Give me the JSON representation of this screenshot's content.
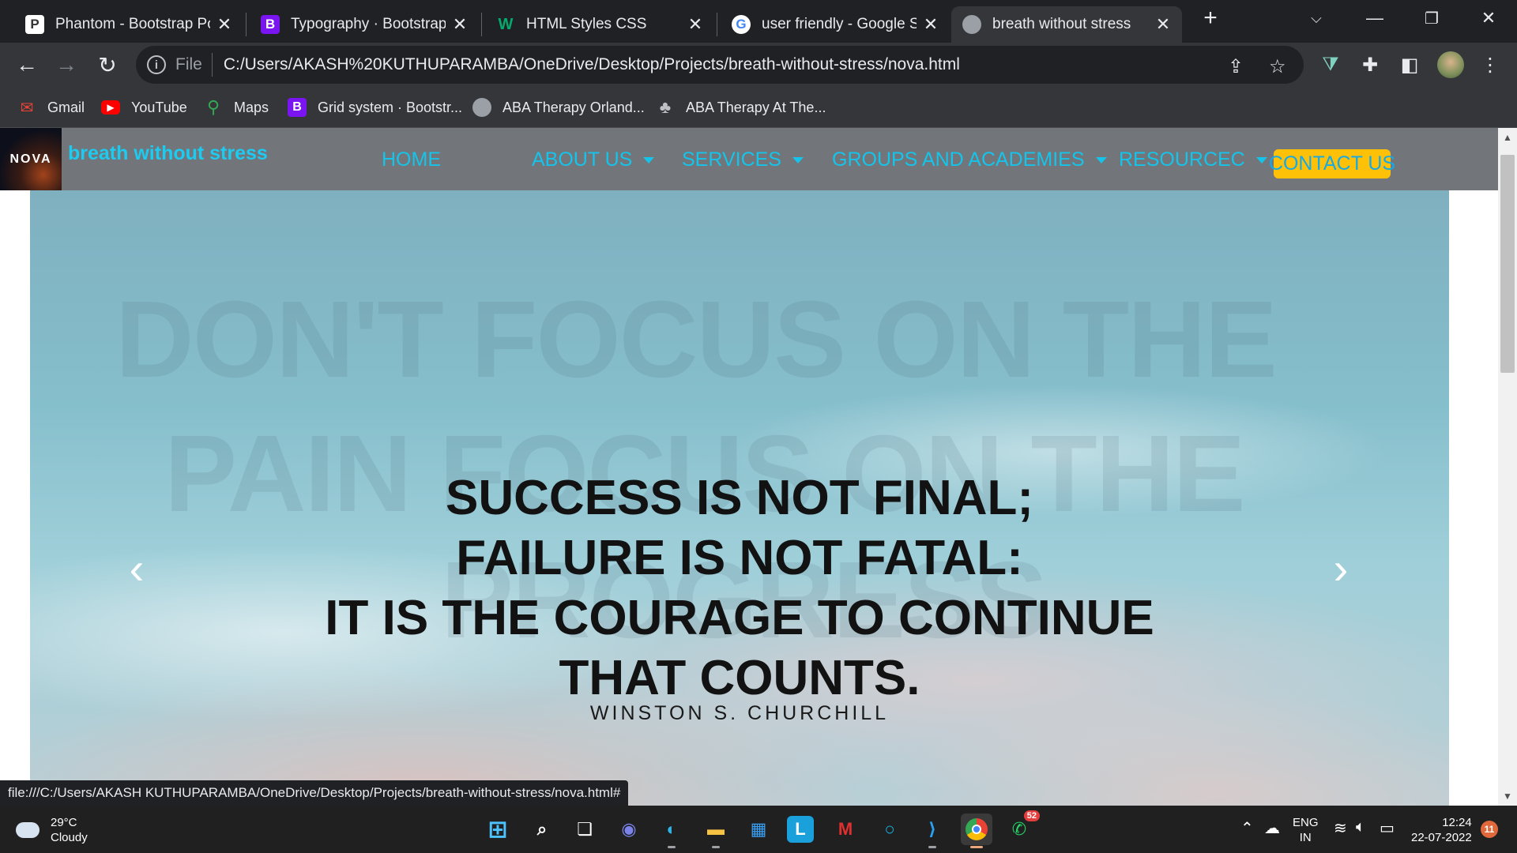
{
  "browser": {
    "tabs": [
      {
        "title": "Phantom - Bootstrap Portfolio",
        "favicon": "P"
      },
      {
        "title": "Typography · Bootstrap v5",
        "favicon": "B"
      },
      {
        "title": "HTML Styles CSS",
        "favicon": "W"
      },
      {
        "title": "user friendly - Google Search",
        "favicon": "G"
      },
      {
        "title": "breath without stress",
        "favicon": "globe"
      }
    ],
    "active_tab_index": 4,
    "new_tab_label": "+",
    "omnibox": {
      "scheme_label": "File",
      "url": "C:/Users/AKASH%20KUTHUPARAMBA/OneDrive/Desktop/Projects/breath-without-stress/nova.html"
    },
    "bookmarks": [
      {
        "label": "Gmail",
        "icon": "gmail-icon"
      },
      {
        "label": "YouTube",
        "icon": "youtube-icon"
      },
      {
        "label": "Maps",
        "icon": "maps-icon"
      },
      {
        "label": "Grid system · Bootstr...",
        "icon": "bootstrap-icon"
      },
      {
        "label": "ABA Therapy Orland...",
        "icon": "globe-icon"
      },
      {
        "label": "ABA Therapy At The...",
        "icon": "tree-icon"
      }
    ],
    "status_url": "file:///C:/Users/AKASH KUTHUPARAMBA/OneDrive/Desktop/Projects/breath-without-stress/nova.html#"
  },
  "site": {
    "logo_text": "NOVA",
    "brand": "breath without stress",
    "menu": [
      {
        "label": "HOME",
        "dropdown": false
      },
      {
        "label": "ABOUT US",
        "dropdown": true
      },
      {
        "label": "SERVICES",
        "dropdown": true
      },
      {
        "label": "GROUPS AND ACADEMIES",
        "dropdown": true
      },
      {
        "label": "RESOURCEC",
        "dropdown": true
      }
    ],
    "contact_label": "CONTACT US",
    "colors": {
      "nav_bg": "#72757a",
      "nav_text": "#15c4ea",
      "contact_bg": "#ffc107"
    },
    "carousel": {
      "background_text": [
        "DON'T FOCUS ON THE",
        "PAIN FOCUS ON THE",
        "PROGRESS"
      ],
      "quote_lines": [
        "SUCCESS IS NOT FINAL;",
        "FAILURE IS NOT FATAL:",
        "IT IS THE COURAGE TO CONTINUE",
        "THAT COUNTS."
      ],
      "author": "WINSTON S. CHURCHILL"
    }
  },
  "taskbar": {
    "weather": {
      "temp": "29°C",
      "condition": "Cloudy"
    },
    "whatsapp_badge": "52",
    "language": {
      "lang": "ENG",
      "region": "IN"
    },
    "clock": {
      "time": "12:24",
      "date": "22-07-2022"
    },
    "notifications": "11"
  }
}
